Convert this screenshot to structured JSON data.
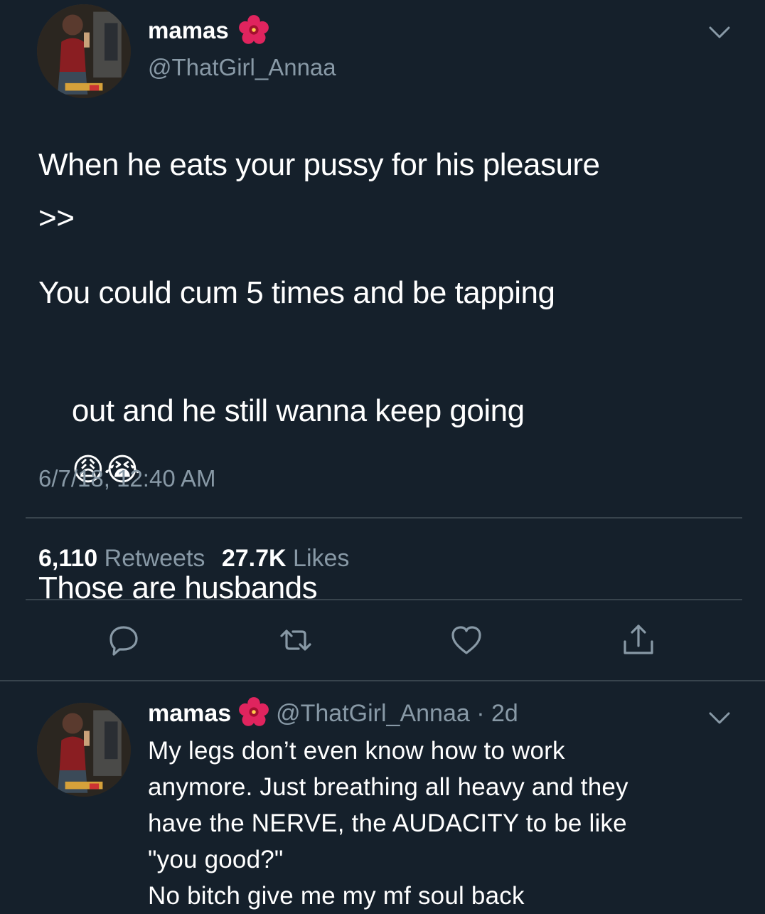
{
  "tweet": {
    "author_name": "mamas",
    "author_handle": "@ThatGirl_Annaa",
    "body_line1": "When he eats your pussy for his pleasure",
    "body_line2": ">>",
    "body_line3": "You could cum 5 times and be tapping",
    "body_line4": "out and he still wanna keep going",
    "body_line5": "Those are husbands",
    "emoji_weary": "😩",
    "emoji_crying": "😭",
    "timestamp": "6/7/18, 12:40 AM",
    "retweets_count": "6,110",
    "retweets_label": "Retweets",
    "likes_count": "27.7K",
    "likes_label": "Likes"
  },
  "reply": {
    "author_name": "mamas",
    "author_handle": "@ThatGirl_Annaa",
    "separator": "·",
    "age": "2d",
    "lines": [
      "My legs don’t even know how to work",
      "anymore. Just breathing all heavy and they",
      "have the NERVE, the AUDACITY to be like",
      "\"you good?\"",
      "No bitch give me my mf soul back"
    ]
  },
  "icons": {
    "name_emoji": "hibiscus-icon",
    "menu": "chevron-down-icon",
    "actions": [
      "reply-icon",
      "retweet-icon",
      "like-icon",
      "share-icon"
    ]
  },
  "colors": {
    "background": "#15202b",
    "secondary_text": "#8899a6",
    "divider": "#38444d"
  }
}
